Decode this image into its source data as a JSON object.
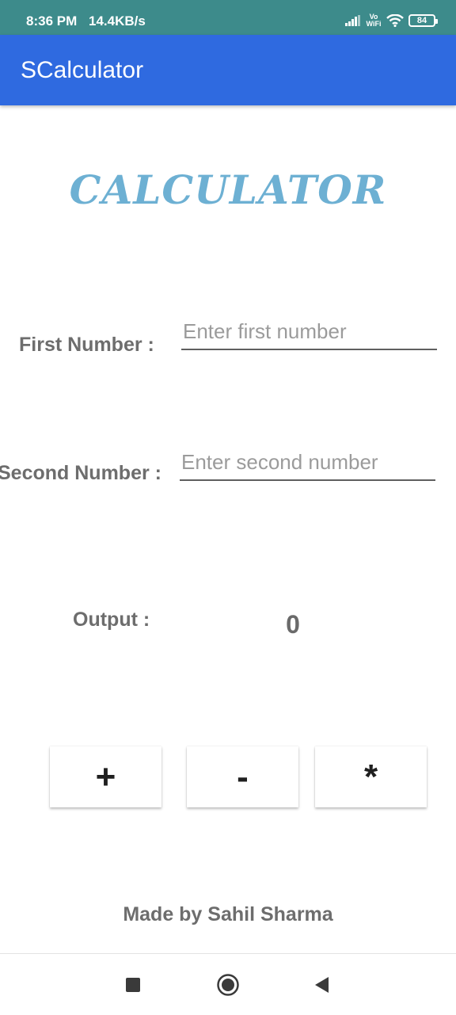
{
  "status_bar": {
    "time": "8:36 PM",
    "net_speed": "14.4KB/s",
    "volte_line1": "Vo",
    "volte_line2": "WiFi",
    "battery": "84"
  },
  "app_bar": {
    "title": "SCalculator"
  },
  "heading": "CALCULATOR",
  "first_number": {
    "label": "First Number :",
    "placeholder": "Enter first number",
    "value": ""
  },
  "second_number": {
    "label": "Second Number :",
    "placeholder": "Enter second number",
    "value": ""
  },
  "output": {
    "label": "Output :",
    "value": "0"
  },
  "operations": [
    {
      "label": "+"
    },
    {
      "label": "-"
    },
    {
      "label": "*"
    }
  ],
  "footer": "Made by Sahil Sharma",
  "colors": {
    "status_bar": "#3d8b8b",
    "app_bar": "#2f6ae0",
    "heading": "#6db0d3",
    "label": "#6d6d6d"
  },
  "icons": [
    "signal-icon",
    "wifi-icon",
    "battery-icon",
    "recents-icon",
    "home-icon",
    "back-icon"
  ]
}
